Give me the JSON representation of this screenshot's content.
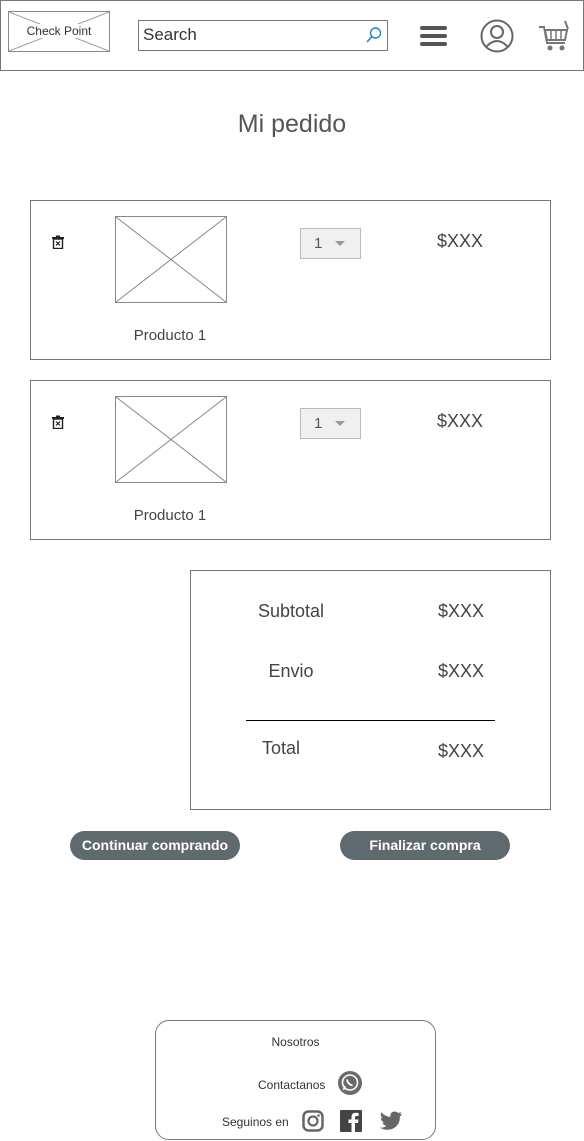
{
  "header": {
    "logo_text": "Check Point",
    "search_placeholder": "Search",
    "icons": [
      "search-icon",
      "menu-icon",
      "user-icon",
      "cart-icon"
    ]
  },
  "page": {
    "title": "Mi pedido"
  },
  "items": [
    {
      "name": "Producto 1",
      "quantity": "1",
      "price": "$XXX"
    },
    {
      "name": "Producto 1",
      "quantity": "1",
      "price": "$XXX"
    }
  ],
  "summary": {
    "subtotal_label": "Subtotal",
    "subtotal_value": "$XXX",
    "shipping_label": "Envio",
    "shipping_value": "$XXX",
    "total_label": "Total",
    "total_value": "$XXX"
  },
  "actions": {
    "continue_label": "Continuar comprando",
    "finish_label": "Finalizar compra"
  },
  "footer": {
    "about": "Nosotros",
    "contact": "Contactanos",
    "follow": "Seguinos en",
    "icons": [
      "whatsapp-icon",
      "instagram-icon",
      "facebook-icon",
      "twitter-icon"
    ]
  },
  "colors": {
    "button_bg": "#5f6a6f",
    "search_icon": "#1e88c7"
  }
}
